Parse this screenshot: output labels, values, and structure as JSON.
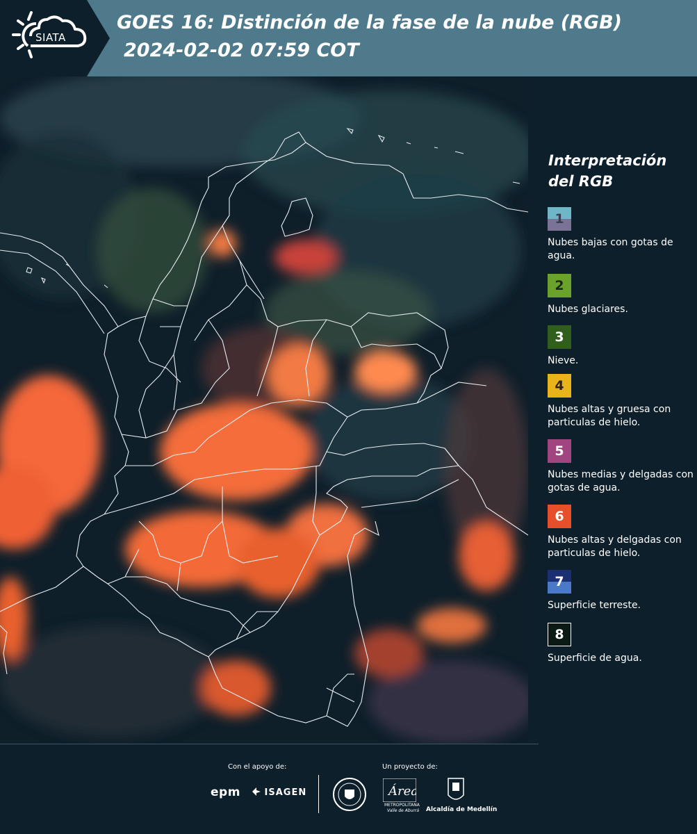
{
  "header": {
    "logo_text": "SIATA",
    "title": "GOES 16: Distinción de la fase de la nube (RGB)",
    "subtitle": "2024-02-02 07:59 COT"
  },
  "legend": {
    "title": "Interpretación del RGB",
    "items": [
      {
        "number": "1",
        "label": "Nubes bajas con gotas de agua.",
        "colors": [
          "#6fb6c7",
          "#7a7395"
        ]
      },
      {
        "number": "2",
        "label": "Nubes glaciares.",
        "colors": [
          "#6aa22c"
        ]
      },
      {
        "number": "3",
        "label": "Nieve.",
        "colors": [
          "#2f5e1d"
        ]
      },
      {
        "number": "4",
        "label": "Nubes altas y gruesa con particulas de hielo.",
        "colors": [
          "#e8b41a"
        ]
      },
      {
        "number": "5",
        "label": "Nubes medias y delgadas con gotas de agua.",
        "colors": [
          "#a0457f"
        ]
      },
      {
        "number": "6",
        "label": "Nubes altas y delgadas con particulas de hielo.",
        "colors": [
          "#e5502b"
        ]
      },
      {
        "number": "7",
        "label": "Superficie terreste.",
        "colors": [
          "#1c2f73",
          "#4a79c8"
        ]
      },
      {
        "number": "8",
        "label": "Superficie de agua.",
        "colors": [
          "#0b1a14"
        ]
      }
    ]
  },
  "footer": {
    "support_label": "Con el apoyo de:",
    "project_label": "Un proyecto de:",
    "sponsors": [
      "epm",
      "ISAGEN"
    ],
    "area_name": "Área",
    "area_line1": "METROPOLITANA",
    "area_line2": "Valle de Aburrá",
    "alcaldia": "Alcaldía de Medellín"
  }
}
